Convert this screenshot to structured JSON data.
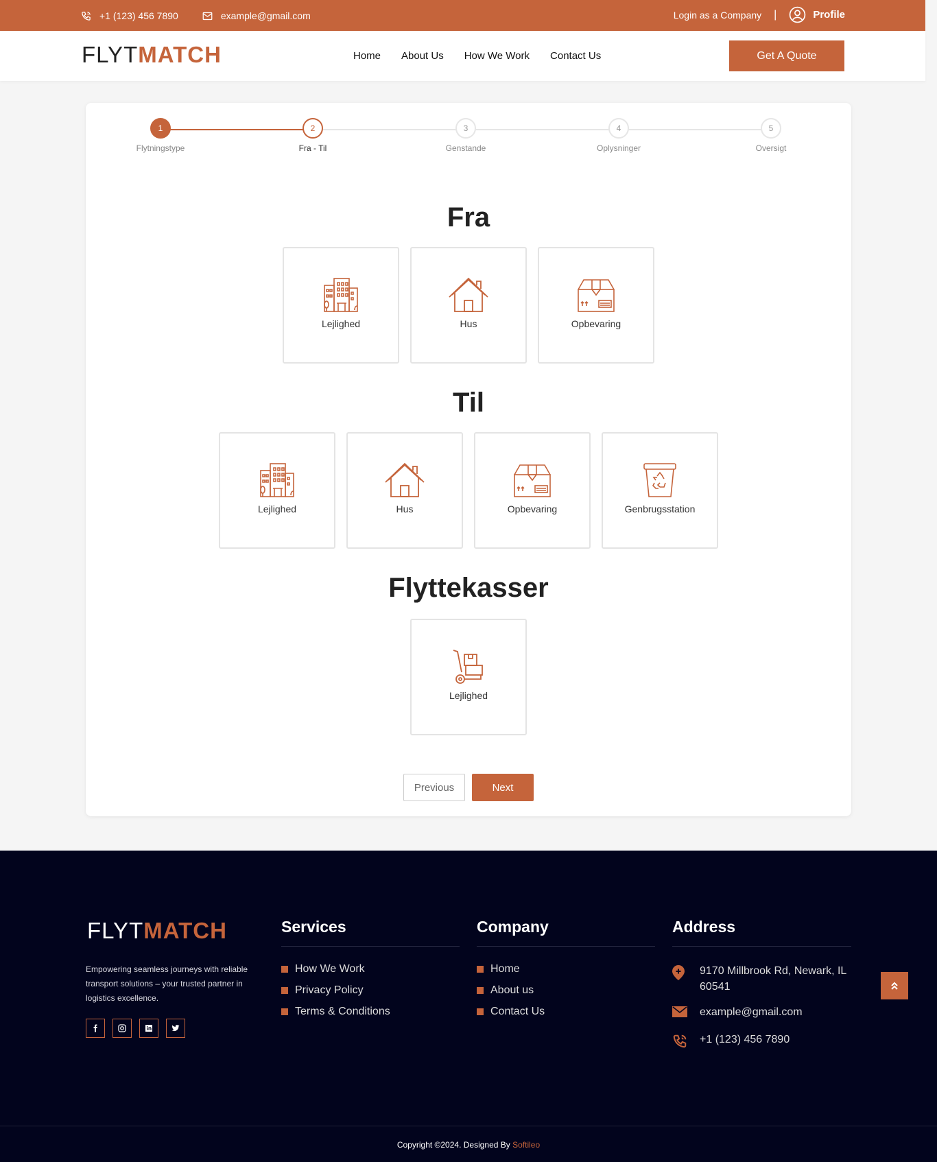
{
  "topbar": {
    "phone": "+1 (123) 456 7890",
    "email": "example@gmail.com",
    "login_company": "Login as a Company",
    "separator": "|",
    "profile": "Profile"
  },
  "header": {
    "logo_flyt": "FLYT",
    "logo_match": "MATCH",
    "nav": [
      "Home",
      "About Us",
      "How We Work",
      "Contact Us"
    ],
    "quote_button": "Get A Quote"
  },
  "stepper": {
    "steps": [
      {
        "number": "1",
        "label": "Flytningstype",
        "state": "done"
      },
      {
        "number": "2",
        "label": "Fra - Til",
        "state": "current"
      },
      {
        "number": "3",
        "label": "Genstande",
        "state": "pending"
      },
      {
        "number": "4",
        "label": "Oplysninger",
        "state": "pending"
      },
      {
        "number": "5",
        "label": "Oversigt",
        "state": "pending"
      }
    ]
  },
  "sections": {
    "fra": {
      "title": "Fra",
      "options": [
        {
          "label": "Lejlighed",
          "icon": "apartment-building-icon"
        },
        {
          "label": "Hus",
          "icon": "house-icon"
        },
        {
          "label": "Opbevaring",
          "icon": "storage-box-icon"
        }
      ]
    },
    "til": {
      "title": "Til",
      "options": [
        {
          "label": "Lejlighed",
          "icon": "apartment-building-icon"
        },
        {
          "label": "Hus",
          "icon": "house-icon"
        },
        {
          "label": "Opbevaring",
          "icon": "storage-box-icon"
        },
        {
          "label": "Genbrugsstation",
          "icon": "recycle-bin-icon"
        }
      ]
    },
    "flyttekasser": {
      "title": "Flyttekasser",
      "options": [
        {
          "label": "Lejlighed",
          "icon": "hand-truck-icon"
        }
      ]
    }
  },
  "buttons": {
    "previous": "Previous",
    "next": "Next"
  },
  "footer": {
    "logo_flyt": "FLYT",
    "logo_match": "MATCH",
    "about": "Empowering seamless journeys with reliable transport solutions – your trusted partner in logistics excellence.",
    "socials": [
      "facebook-icon",
      "instagram-icon",
      "linkedin-icon",
      "twitter-icon"
    ],
    "services": {
      "title": "Services",
      "links": [
        "How We Work",
        "Privacy Policy",
        "Terms & Conditions"
      ]
    },
    "company": {
      "title": "Company",
      "links": [
        "Home",
        "About us",
        "Contact Us"
      ]
    },
    "address": {
      "title": "Address",
      "street": "9170 Millbrook Rd, Newark, IL 60541",
      "email": "example@gmail.com",
      "phone": "+1 (123) 456 7890"
    },
    "copyright_text": "Copyright ©2024. Designed By ",
    "copyright_brand": "Softileo"
  },
  "colors": {
    "accent": "#c5643b",
    "footer_bg": "#02041d"
  }
}
